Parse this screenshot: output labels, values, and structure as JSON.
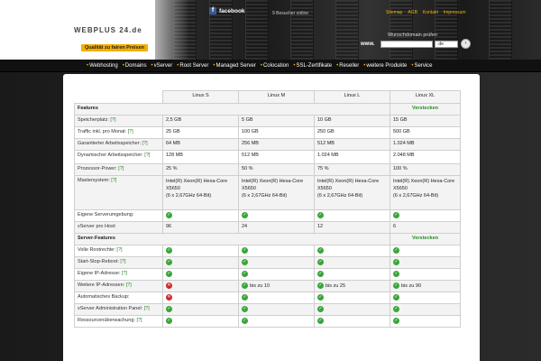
{
  "header": {
    "logo": "WEBPLUS 24.de",
    "slogan": "Qualität zu fairen Preisen",
    "facebook": "facebook",
    "facebook_icon": "facebook-icon",
    "visitors": "9 Besucher online",
    "top_links": [
      "Sitemap",
      "AGB",
      "Kontakt",
      "Impressum"
    ],
    "domain_title": "Wunschdomain prüfen",
    "domain_www": "www.",
    "domain_value": "",
    "domain_tld": ".de",
    "domain_go": "›"
  },
  "mainnav": [
    "Webhosting",
    "Domains",
    "vServer",
    "Root Server",
    "Managed Server",
    "Colocation",
    "SSL-Zertifikate",
    "Reseller",
    "weitere Produkte",
    "Service"
  ],
  "table": {
    "plans": [
      "Linux S",
      "Linux M",
      "Linux L",
      "Linux XL"
    ],
    "features_title": "Features",
    "toggle_label": "Verstecken",
    "help": "[?]",
    "rows": [
      {
        "label": "Speicherplatz:",
        "help": true,
        "cells": [
          "2,5 GB",
          "5 GB",
          "10 GB",
          "15 GB"
        ]
      },
      {
        "label": "Traffic inkl. pro Monat:",
        "help": true,
        "cells": [
          "25 GB",
          "100 GB",
          "250 GB",
          "500 GB"
        ]
      },
      {
        "label": "Garantierter Arbeitsspeicher:",
        "help": true,
        "cells": [
          "64 MB",
          "256 MB",
          "512 MB",
          "1.024 MB"
        ]
      },
      {
        "label": "Dynamischer Arbeitsspeicher:",
        "help": true,
        "cells": [
          "128 MB",
          "512 MB",
          "1.024 MB",
          "2.048 MB"
        ]
      },
      {
        "label": "Prozessor-Power:",
        "help": true,
        "cells": [
          "25 %",
          "50 %",
          "75 %",
          "100 %"
        ]
      }
    ],
    "master": {
      "label": "Mastersystem:",
      "help": true,
      "lines": [
        "Intel(R) Xeon(R) Hexa-Core",
        "X5650",
        "(6 x 2,67GHz 64-Bit)"
      ]
    },
    "rows2": [
      {
        "label": "Eigene Serverumgebung:",
        "help": false
      },
      {
        "label": "vServer pro Host:",
        "help": false,
        "cells": [
          "96",
          "24",
          "12",
          "6"
        ]
      }
    ],
    "server_features_title": "Server-Features",
    "server_rows": [
      {
        "label": "Volle Rootrechte:",
        "help": true,
        "marks": [
          "check",
          "check",
          "check",
          "check"
        ],
        "texts": [
          "",
          "",
          "",
          ""
        ]
      },
      {
        "label": "Start-Stop-Reboot:",
        "help": true,
        "marks": [
          "check",
          "check",
          "check",
          "check"
        ],
        "texts": [
          "",
          "",
          "",
          ""
        ]
      },
      {
        "label": "Eigene IP-Adresse:",
        "help": true,
        "marks": [
          "check",
          "check",
          "check",
          "check"
        ],
        "texts": [
          "",
          "",
          "",
          ""
        ]
      },
      {
        "label": "Weitere IP-Adressen:",
        "help": true,
        "marks": [
          "cross",
          "check",
          "check",
          "check"
        ],
        "texts": [
          "",
          "bis zu 10",
          "bis zu 25",
          "bis zu 90"
        ]
      },
      {
        "label": "Automatisches Backup:",
        "help": false,
        "marks": [
          "cross",
          "check",
          "check",
          "check"
        ],
        "texts": [
          "",
          "",
          "",
          ""
        ]
      },
      {
        "label": "vServer Administration Panel:",
        "help": true,
        "marks": [
          "check",
          "check",
          "check",
          "check"
        ],
        "texts": [
          "",
          "",
          "",
          ""
        ]
      },
      {
        "label": "Ressourcenüberwachung:",
        "help": true,
        "marks": [
          "check",
          "check",
          "check",
          "check"
        ],
        "texts": [
          "",
          "",
          "",
          ""
        ]
      }
    ],
    "check_icon": "check-icon",
    "cross_icon": "cross-icon",
    "check_glyph": "✓",
    "cross_glyph": "✕"
  },
  "colors": {
    "accent": "#f0b000",
    "check": "#3aa53a",
    "cross": "#cc2a2a",
    "toggle": "#2a8a2a"
  }
}
